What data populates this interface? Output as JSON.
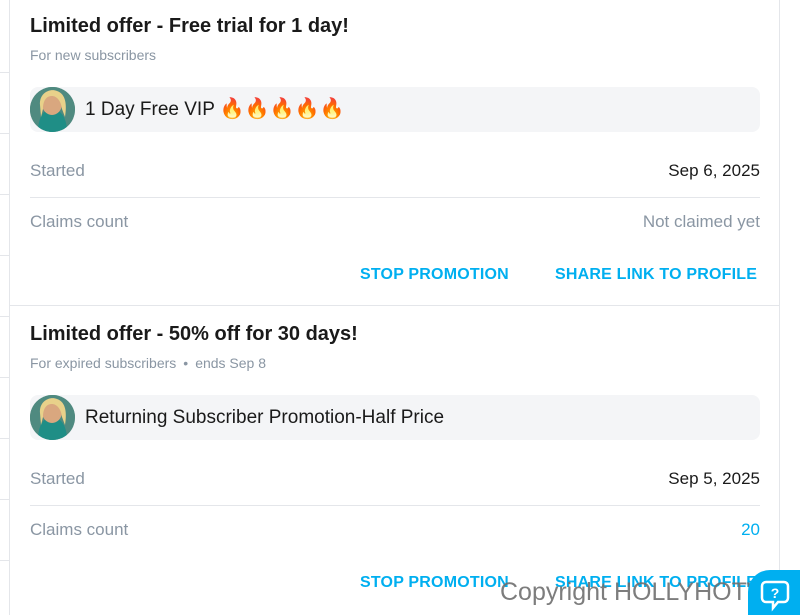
{
  "promotions": [
    {
      "title": "Limited offer - Free trial for 1 day!",
      "audience": "For new subscribers",
      "ends": "",
      "message": "1 Day Free VIP",
      "message_emoji": "🔥🔥🔥🔥🔥",
      "started_label": "Started",
      "started_value": "Sep 6, 2025",
      "claims_label": "Claims count",
      "claims_value": "Not claimed yet",
      "stop_label": "STOP PROMOTION",
      "share_label": "SHARE LINK TO PROFILE"
    },
    {
      "title": "Limited offer - 50% off for 30 days!",
      "audience": "For expired subscribers",
      "ends": "ends Sep 8",
      "message": "Returning Subscriber Promotion-Half Price",
      "message_emoji": "",
      "started_label": "Started",
      "started_value": "Sep 5, 2025",
      "claims_label": "Claims count",
      "claims_value": "20",
      "stop_label": "STOP PROMOTION",
      "share_label": "SHARE LINK TO PROFILE"
    }
  ],
  "separator": "•",
  "watermark": "Copyright HOLLYHOTWIFE",
  "colors": {
    "accent": "#00aff0",
    "muted_text": "#8a96a3",
    "primary_text": "#1a1a1a",
    "panel_bg": "#f4f5f7",
    "divider": "#e4e6ea"
  },
  "icons": {
    "avatar": "profile-avatar",
    "help": "help-chat-icon"
  }
}
